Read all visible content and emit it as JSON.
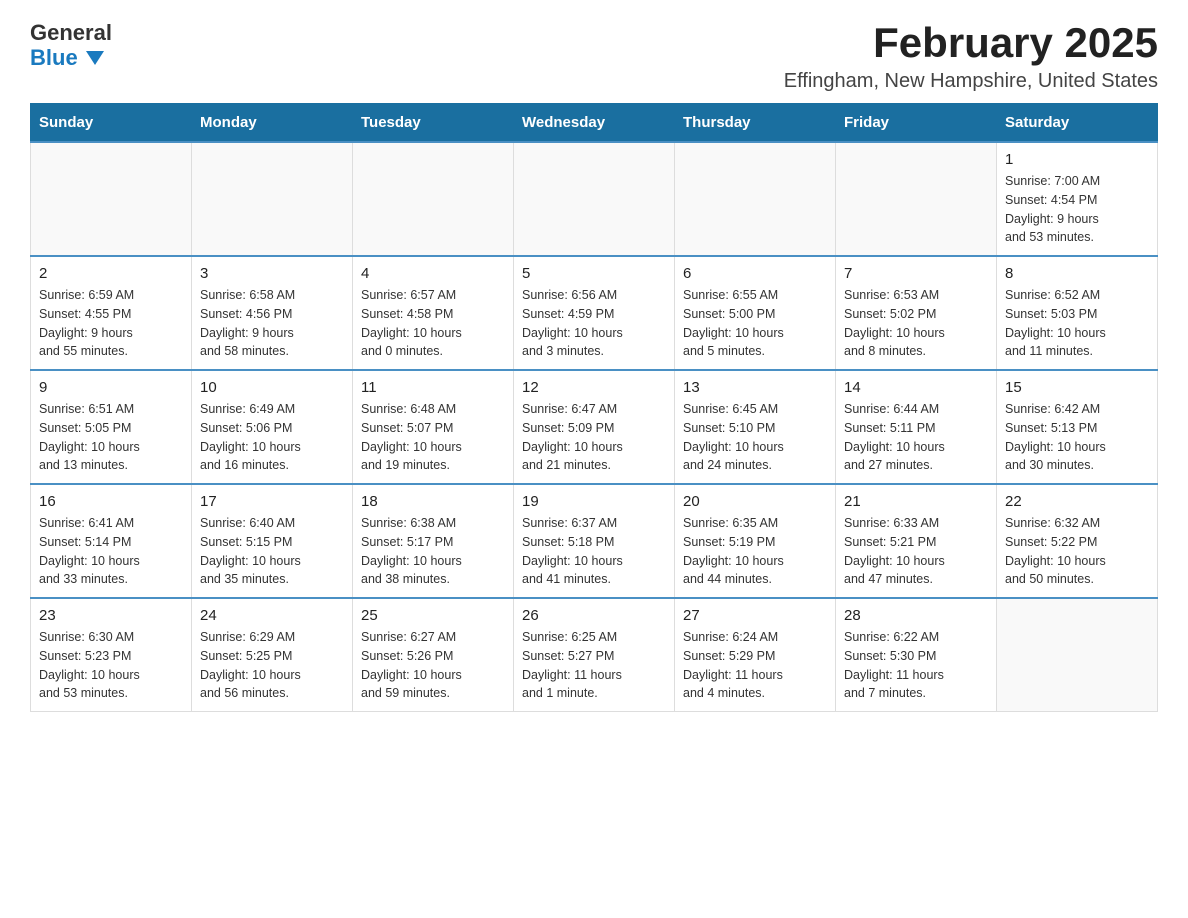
{
  "header": {
    "logo_general": "General",
    "logo_blue": "Blue",
    "month_title": "February 2025",
    "location": "Effingham, New Hampshire, United States"
  },
  "days_of_week": [
    "Sunday",
    "Monday",
    "Tuesday",
    "Wednesday",
    "Thursday",
    "Friday",
    "Saturday"
  ],
  "weeks": [
    [
      {
        "day": "",
        "info": ""
      },
      {
        "day": "",
        "info": ""
      },
      {
        "day": "",
        "info": ""
      },
      {
        "day": "",
        "info": ""
      },
      {
        "day": "",
        "info": ""
      },
      {
        "day": "",
        "info": ""
      },
      {
        "day": "1",
        "info": "Sunrise: 7:00 AM\nSunset: 4:54 PM\nDaylight: 9 hours\nand 53 minutes."
      }
    ],
    [
      {
        "day": "2",
        "info": "Sunrise: 6:59 AM\nSunset: 4:55 PM\nDaylight: 9 hours\nand 55 minutes."
      },
      {
        "day": "3",
        "info": "Sunrise: 6:58 AM\nSunset: 4:56 PM\nDaylight: 9 hours\nand 58 minutes."
      },
      {
        "day": "4",
        "info": "Sunrise: 6:57 AM\nSunset: 4:58 PM\nDaylight: 10 hours\nand 0 minutes."
      },
      {
        "day": "5",
        "info": "Sunrise: 6:56 AM\nSunset: 4:59 PM\nDaylight: 10 hours\nand 3 minutes."
      },
      {
        "day": "6",
        "info": "Sunrise: 6:55 AM\nSunset: 5:00 PM\nDaylight: 10 hours\nand 5 minutes."
      },
      {
        "day": "7",
        "info": "Sunrise: 6:53 AM\nSunset: 5:02 PM\nDaylight: 10 hours\nand 8 minutes."
      },
      {
        "day": "8",
        "info": "Sunrise: 6:52 AM\nSunset: 5:03 PM\nDaylight: 10 hours\nand 11 minutes."
      }
    ],
    [
      {
        "day": "9",
        "info": "Sunrise: 6:51 AM\nSunset: 5:05 PM\nDaylight: 10 hours\nand 13 minutes."
      },
      {
        "day": "10",
        "info": "Sunrise: 6:49 AM\nSunset: 5:06 PM\nDaylight: 10 hours\nand 16 minutes."
      },
      {
        "day": "11",
        "info": "Sunrise: 6:48 AM\nSunset: 5:07 PM\nDaylight: 10 hours\nand 19 minutes."
      },
      {
        "day": "12",
        "info": "Sunrise: 6:47 AM\nSunset: 5:09 PM\nDaylight: 10 hours\nand 21 minutes."
      },
      {
        "day": "13",
        "info": "Sunrise: 6:45 AM\nSunset: 5:10 PM\nDaylight: 10 hours\nand 24 minutes."
      },
      {
        "day": "14",
        "info": "Sunrise: 6:44 AM\nSunset: 5:11 PM\nDaylight: 10 hours\nand 27 minutes."
      },
      {
        "day": "15",
        "info": "Sunrise: 6:42 AM\nSunset: 5:13 PM\nDaylight: 10 hours\nand 30 minutes."
      }
    ],
    [
      {
        "day": "16",
        "info": "Sunrise: 6:41 AM\nSunset: 5:14 PM\nDaylight: 10 hours\nand 33 minutes."
      },
      {
        "day": "17",
        "info": "Sunrise: 6:40 AM\nSunset: 5:15 PM\nDaylight: 10 hours\nand 35 minutes."
      },
      {
        "day": "18",
        "info": "Sunrise: 6:38 AM\nSunset: 5:17 PM\nDaylight: 10 hours\nand 38 minutes."
      },
      {
        "day": "19",
        "info": "Sunrise: 6:37 AM\nSunset: 5:18 PM\nDaylight: 10 hours\nand 41 minutes."
      },
      {
        "day": "20",
        "info": "Sunrise: 6:35 AM\nSunset: 5:19 PM\nDaylight: 10 hours\nand 44 minutes."
      },
      {
        "day": "21",
        "info": "Sunrise: 6:33 AM\nSunset: 5:21 PM\nDaylight: 10 hours\nand 47 minutes."
      },
      {
        "day": "22",
        "info": "Sunrise: 6:32 AM\nSunset: 5:22 PM\nDaylight: 10 hours\nand 50 minutes."
      }
    ],
    [
      {
        "day": "23",
        "info": "Sunrise: 6:30 AM\nSunset: 5:23 PM\nDaylight: 10 hours\nand 53 minutes."
      },
      {
        "day": "24",
        "info": "Sunrise: 6:29 AM\nSunset: 5:25 PM\nDaylight: 10 hours\nand 56 minutes."
      },
      {
        "day": "25",
        "info": "Sunrise: 6:27 AM\nSunset: 5:26 PM\nDaylight: 10 hours\nand 59 minutes."
      },
      {
        "day": "26",
        "info": "Sunrise: 6:25 AM\nSunset: 5:27 PM\nDaylight: 11 hours\nand 1 minute."
      },
      {
        "day": "27",
        "info": "Sunrise: 6:24 AM\nSunset: 5:29 PM\nDaylight: 11 hours\nand 4 minutes."
      },
      {
        "day": "28",
        "info": "Sunrise: 6:22 AM\nSunset: 5:30 PM\nDaylight: 11 hours\nand 7 minutes."
      },
      {
        "day": "",
        "info": ""
      }
    ]
  ]
}
